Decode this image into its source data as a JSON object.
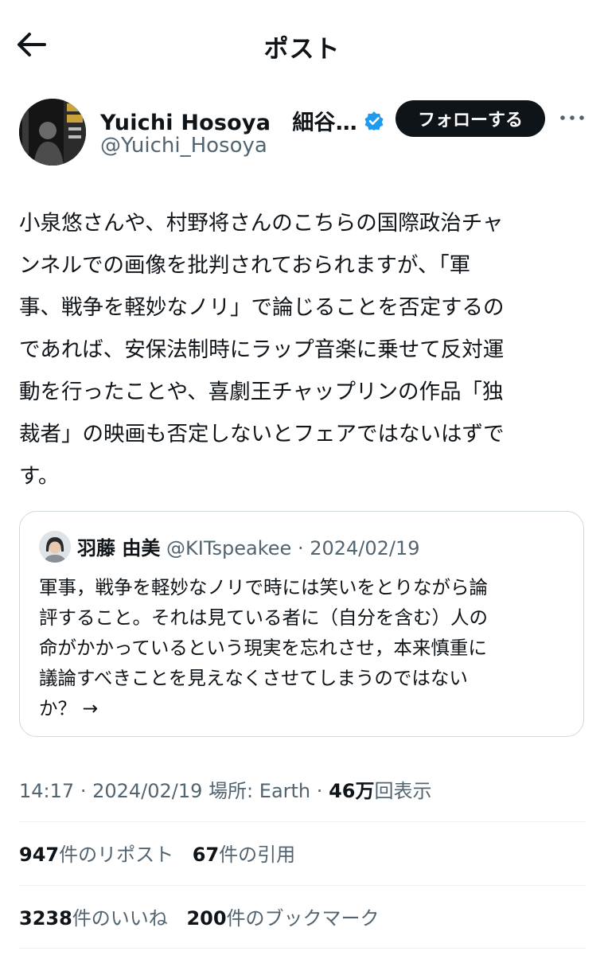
{
  "header": {
    "title": "ポスト",
    "back_icon": "arrow-left-icon"
  },
  "author": {
    "display_name": "Yuichi Hosoya　細谷…",
    "handle": "@Yuichi_Hosoya",
    "verified_icon": "verified-badge-icon",
    "verified_color": "#1d9bf0",
    "follow_label": "フォローする",
    "more_icon": "more-horizontal-icon"
  },
  "tweet": {
    "lines": [
      "小泉悠さんや、村野将さんのこちらの国際政治チャ",
      "ンネルでの画像を批判されておられますが、「軍",
      "事、戦争を軽妙なノリ」で論じることを否定するの",
      "であれば、安保法制時にラップ音楽に乗せて反対運",
      "動を行ったことや、喜劇王チャップリンの作品「独",
      "裁者」の映画も否定しないとフェアではないはずで",
      "す。"
    ]
  },
  "quote": {
    "name": "羽藤 由美",
    "handle": "@KITspeakee",
    "separator": "·",
    "date": "2024/02/19",
    "lines": [
      "軍事，戦争を軽妙なノリで時には笑いをとりながら論",
      "評すること。それは見ている者に（自分を含む）人の",
      "命がかかっているという現実を忘れさせ，本来慎重に",
      "議論すべきことを見えなくさせてしまうのではない",
      "か？ →"
    ]
  },
  "meta": {
    "time": "14:17",
    "sep1": "·",
    "date": "2024/02/19",
    "location": "場所: Earth",
    "sep2": "·",
    "views_count": "46万",
    "views_label": "回表示"
  },
  "stats": {
    "reposts_count": "947",
    "reposts_label": "件のリポスト",
    "quotes_count": "67",
    "quotes_label": "件の引用",
    "likes_count": "3238",
    "likes_label": "件のいいね",
    "bookmarks_count": "200",
    "bookmarks_label": "件のブックマーク"
  }
}
